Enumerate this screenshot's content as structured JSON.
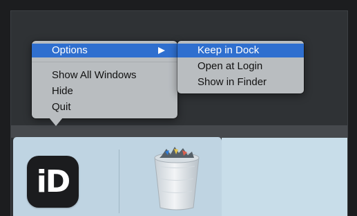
{
  "context_menu": {
    "options_label": "Options",
    "show_all_windows_label": "Show All Windows",
    "hide_label": "Hide",
    "quit_label": "Quit"
  },
  "submenu": {
    "keep_in_dock_label": "Keep in Dock",
    "open_at_login_label": "Open at Login",
    "show_in_finder_label": "Show in Finder"
  },
  "dock": {
    "app_icon_text": "iD",
    "app_icon_name": "indesign-app-icon",
    "trash_icon_name": "trash-icon"
  },
  "colors": {
    "highlight": "#2f6fcf",
    "menu_background": "#b9bdc0",
    "dock_background": "#c5dbe9",
    "desktop_background": "#2f3235"
  }
}
